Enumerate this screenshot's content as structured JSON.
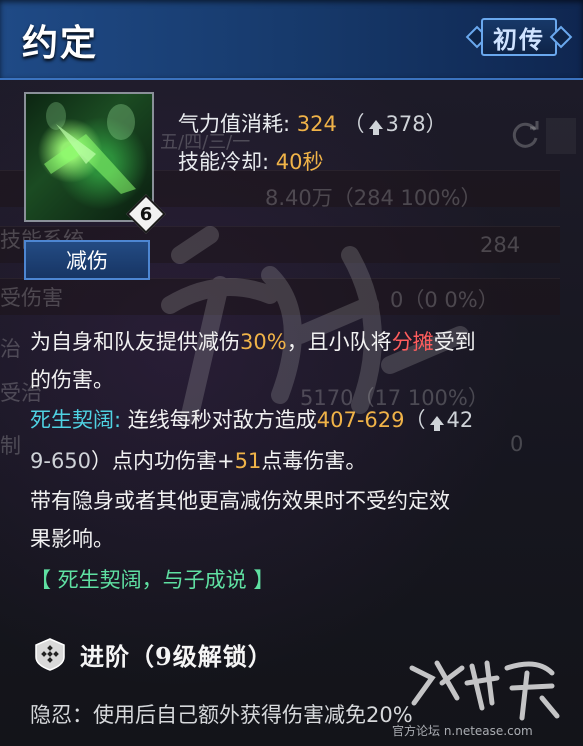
{
  "header": {
    "title": "约定",
    "rank_badge": "初传"
  },
  "skill": {
    "level": "6",
    "type_tag": "减伤",
    "stats": {
      "energy_label": "气力值消耗:",
      "energy_value": "324",
      "energy_upgraded": "378",
      "cooldown_label": "技能冷却:",
      "cooldown_value": "40秒"
    }
  },
  "background_text": {
    "col_header": "五/四/三/一",
    "row1_value": "8.40万（284  100%）",
    "row2_label": "技能系统",
    "row2_value": "284",
    "row3_label": "受伤害",
    "row3_value": "0（0  0%）",
    "row4_label": "治",
    "row5_label": "受治",
    "row5_value": "5170（17  100%）",
    "row6_label": "制",
    "row6_value": "0"
  },
  "description": {
    "line1_a": "为自身和队友提供减伤",
    "line1_b": "30%",
    "line1_c": "，且小队将",
    "line1_d": "分摊",
    "line1_e": "受到",
    "line2": "的伤害。",
    "line3_name": "死生契阔:",
    "line3_a": " 连线每秒对敌方造成",
    "line3_b": "407-629",
    "line3_c": "（",
    "line3_d": "42",
    "line4_a": "9-650",
    "line4_b": "）点内功伤害+",
    "line4_c": "51",
    "line4_d": "点毒伤害。",
    "line5": "带有隐身或者其他更高减伤效果时不受约定效",
    "line6": "果影响。",
    "line7": "【 死生契阔，与子成说 】"
  },
  "advance": {
    "title": "进阶（9级解锁）",
    "line": "隐忍：使用后自己额外获得伤害减免20%"
  },
  "watermark": {
    "url": "官方论坛 n.netease.com"
  },
  "colors": {
    "highlight_yellow": "#f0b348",
    "highlight_red": "#ff5d5d",
    "highlight_cyan": "#4fd2e2",
    "highlight_green": "#5fe0a2",
    "header_blue": "#1f4a86"
  }
}
